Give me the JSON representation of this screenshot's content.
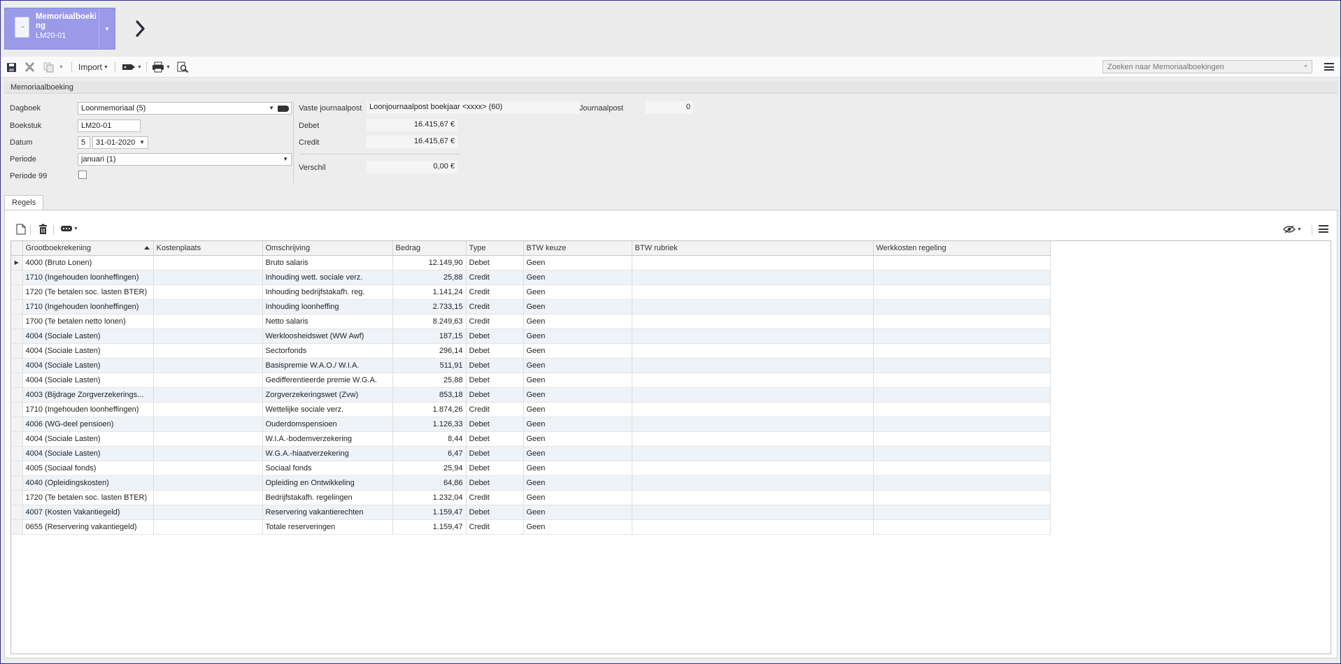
{
  "header": {
    "doc_title": "Memoriaalboeking",
    "doc_code": "LM20-01"
  },
  "toolbar": {
    "import_label": "Import",
    "search_placeholder": "Zoeken naar Memoriaalboekingen"
  },
  "section": {
    "title": "Memoriaalboeking"
  },
  "form": {
    "dagboek_label": "Dagboek",
    "dagboek_value": "Loonmemoriaal (5)",
    "boekstuk_label": "Boekstuk",
    "boekstuk_value": "LM20-01",
    "datum_label": "Datum",
    "datum_day": "5",
    "datum_value": "31-01-2020",
    "periode_label": "Periode",
    "periode_value": "januari (1)",
    "periode99_label": "Periode 99",
    "vaste_label": "Vaste journaalpost",
    "vaste_value": "Loonjournaalpost boekjaar <xxxx> (60)",
    "journaalpost_label": "Journaalpost",
    "journaalpost_value": "0",
    "debet_label": "Debet",
    "debet_value": "16.415,67 €",
    "credit_label": "Credit",
    "credit_value": "16.415,67 €",
    "verschil_label": "Verschil",
    "verschil_value": "0,00 €"
  },
  "tabs": [
    {
      "label": "Regels"
    }
  ],
  "grid": {
    "columns": [
      "Grootboekrekening",
      "Kostenplaats",
      "Omschrijving",
      "Bedrag",
      "Type",
      "BTW keuze",
      "BTW rubriek",
      "Werkkosten regeling"
    ],
    "rows": [
      [
        "4000 (Bruto Lonen)",
        "",
        "Bruto salaris",
        "12.149,90",
        "Debet",
        "Geen",
        "",
        ""
      ],
      [
        "1710 (Ingehouden loonheffingen)",
        "",
        "Inhouding wett. sociale verz.",
        "25,88",
        "Credit",
        "Geen",
        "",
        ""
      ],
      [
        "1720 (Te betalen soc. lasten BTER)",
        "",
        "Inhouding bedrijfstakafh. reg.",
        "1.141,24",
        "Credit",
        "Geen",
        "",
        ""
      ],
      [
        "1710 (Ingehouden loonheffingen)",
        "",
        "Inhouding loonheffing",
        "2.733,15",
        "Credit",
        "Geen",
        "",
        ""
      ],
      [
        "1700 (Te betalen netto lonen)",
        "",
        "Netto salaris",
        "8.249,63",
        "Credit",
        "Geen",
        "",
        ""
      ],
      [
        "4004 (Sociale Lasten)",
        "",
        "Werkloosheidswet (WW Awf)",
        "187,15",
        "Debet",
        "Geen",
        "",
        ""
      ],
      [
        "4004 (Sociale Lasten)",
        "",
        "Sectorfonds",
        "296,14",
        "Debet",
        "Geen",
        "",
        ""
      ],
      [
        "4004 (Sociale Lasten)",
        "",
        "Basispremie W.A.O./ W.I.A.",
        "511,91",
        "Debet",
        "Geen",
        "",
        ""
      ],
      [
        "4004 (Sociale Lasten)",
        "",
        "Gedifferentieerde premie W.G.A.",
        "25,88",
        "Debet",
        "Geen",
        "",
        ""
      ],
      [
        "4003 (Bijdrage Zorgverzekerings...",
        "",
        "Zorgverzekeringswet (Zvw)",
        "853,18",
        "Debet",
        "Geen",
        "",
        ""
      ],
      [
        "1710 (Ingehouden loonheffingen)",
        "",
        "Wettelijke sociale verz.",
        "1.874,26",
        "Credit",
        "Geen",
        "",
        ""
      ],
      [
        "4006 (WG-deel pensioen)",
        "",
        "Ouderdomspensioen",
        "1.126,33",
        "Debet",
        "Geen",
        "",
        ""
      ],
      [
        "4004 (Sociale Lasten)",
        "",
        "W.I.A.-bodemverzekering",
        "8,44",
        "Debet",
        "Geen",
        "",
        ""
      ],
      [
        "4004 (Sociale Lasten)",
        "",
        "W.G.A.-hiaatverzekering",
        "6,47",
        "Debet",
        "Geen",
        "",
        ""
      ],
      [
        "4005 (Sociaal fonds)",
        "",
        "Sociaal fonds",
        "25,94",
        "Debet",
        "Geen",
        "",
        ""
      ],
      [
        "4040 (Opleidingskosten)",
        "",
        "Opleiding en Ontwikkeling",
        "64,86",
        "Debet",
        "Geen",
        "",
        ""
      ],
      [
        "1720 (Te betalen soc. lasten BTER)",
        "",
        "Bedrijfstakafh. regelingen",
        "1.232,04",
        "Credit",
        "Geen",
        "",
        ""
      ],
      [
        "4007 (Kosten Vakantiegeld)",
        "",
        "Reservering vakantierechten",
        "1.159,47",
        "Debet",
        "Geen",
        "",
        ""
      ],
      [
        "0655 (Reservering vakantiegeld)",
        "",
        "Totale reserveringen",
        "1.159,47",
        "Credit",
        "Geen",
        "",
        ""
      ]
    ]
  },
  "colors": {
    "tile_bg": "#9a9ae8",
    "row_alt": "#eef3f8",
    "frame_border": "#2e2e8a"
  }
}
